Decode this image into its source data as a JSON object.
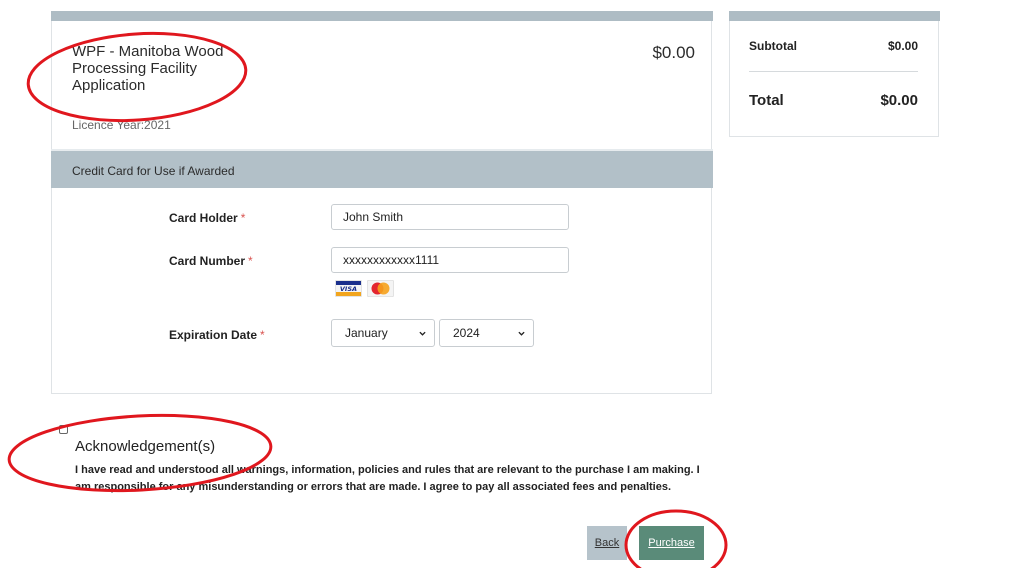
{
  "item": {
    "title": "WPF - Manitoba Wood Processing Facility Application",
    "price": "$0.00",
    "licence_year": "Licence Year:2021"
  },
  "credit_card": {
    "section_title": "Credit Card for Use if Awarded",
    "required_mark": "*",
    "card_holder": {
      "label": "Card Holder",
      "value": "John Smith"
    },
    "card_number": {
      "label": "Card Number",
      "value": "xxxxxxxxxxxx1111"
    },
    "accepted_cards": [
      "visa-icon",
      "mastercard-icon"
    ],
    "expiration": {
      "label": "Expiration Date",
      "month": "January",
      "year": "2024"
    }
  },
  "summary": {
    "subtotal_label": "Subtotal",
    "subtotal_value": "$0.00",
    "total_label": "Total",
    "total_value": "$0.00"
  },
  "acknowledgement": {
    "title": "Acknowledgement(s)",
    "text": "I have read and understood all warnings, information, policies and rules that are relevant to the purchase I am making. I am responsible for any misunderstanding or errors that are made. I agree to pay all associated fees and penalties.",
    "checked": false
  },
  "buttons": {
    "back_label": "Back",
    "purchase_label": "Purchase"
  },
  "colors": {
    "header_bar": "#aebcc4",
    "purchase_button": "#5a8b79",
    "back_button": "#b6c3cb",
    "annotation": "#e0171e",
    "required": "#d9534f"
  }
}
